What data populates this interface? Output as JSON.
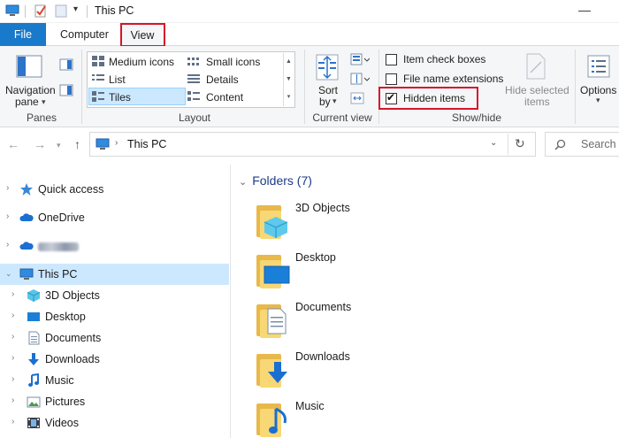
{
  "window": {
    "title": "This PC",
    "controls": {
      "minimize": "—",
      "maximize": "☐"
    }
  },
  "ribbon_tabs": {
    "file": "File",
    "computer": "Computer",
    "view": "View"
  },
  "ribbon": {
    "panes": {
      "navigation_pane_l1": "Navigation",
      "navigation_pane_l2": "pane",
      "group": "Panes"
    },
    "layout": {
      "items": [
        "Medium icons",
        "Small icons",
        "List",
        "Details",
        "Tiles",
        "Content"
      ],
      "selected": "Tiles",
      "group": "Layout"
    },
    "current_view": {
      "sort_l1": "Sort",
      "sort_l2": "by",
      "group": "Current view"
    },
    "show_hide": {
      "item_check_boxes": "Item check boxes",
      "file_name_extensions": "File name extensions",
      "hidden_items": "Hidden items",
      "hidden_items_checked": true,
      "hide_selected_l1": "Hide selected",
      "hide_selected_l2": "items",
      "group": "Show/hide"
    },
    "options": "Options"
  },
  "address": {
    "path": "This PC",
    "search_placeholder": "Search"
  },
  "nav": {
    "items": [
      {
        "label": "Quick access",
        "icon": "star-icon"
      },
      {
        "label": "OneDrive",
        "icon": "cloud-icon"
      },
      {
        "label": "",
        "icon": "cloud-icon"
      },
      {
        "label": "This PC",
        "icon": "computer-icon"
      },
      {
        "label": "3D Objects",
        "icon": "cube-icon"
      },
      {
        "label": "Desktop",
        "icon": "desktop-icon"
      },
      {
        "label": "Documents",
        "icon": "document-icon"
      },
      {
        "label": "Downloads",
        "icon": "download-icon"
      },
      {
        "label": "Music",
        "icon": "music-icon"
      },
      {
        "label": "Pictures",
        "icon": "picture-icon"
      },
      {
        "label": "Videos",
        "icon": "video-icon"
      }
    ]
  },
  "content": {
    "group_title": "Folders (7)",
    "folders": [
      "3D Objects",
      "Desktop",
      "Documents",
      "Downloads",
      "Music"
    ]
  },
  "colors": {
    "accent": "#1979ca",
    "selection": "#cce8ff",
    "highlight_box": "#d7142a",
    "folder": "#f8d775"
  }
}
